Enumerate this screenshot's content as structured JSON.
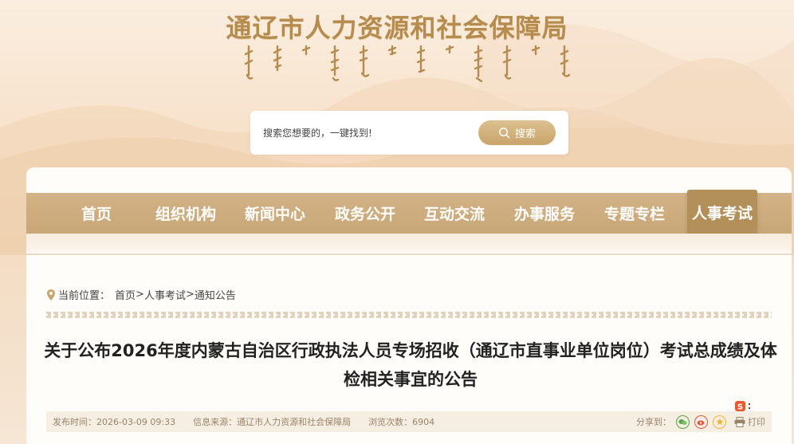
{
  "header": {
    "site_title": "通辽市人力资源和社会保障局"
  },
  "search": {
    "placeholder": "搜索您想要的，一键找到!",
    "button_label": "搜索"
  },
  "nav": {
    "items": [
      {
        "label": "首页"
      },
      {
        "label": "组织机构"
      },
      {
        "label": "新闻中心"
      },
      {
        "label": "政务公开"
      },
      {
        "label": "互动交流"
      },
      {
        "label": "办事服务"
      },
      {
        "label": "专题专栏"
      },
      {
        "label": "人事考试",
        "active": true
      }
    ]
  },
  "breadcrumb": {
    "prefix": "当前位置：",
    "items": [
      "首页",
      "人事考试",
      "通知公告"
    ],
    "separator": ">"
  },
  "article": {
    "title": "关于公布2026年度内蒙古自治区行政执法人员专场招收（通辽市直事业单位岗位）考试总成绩及体检相关事宜的公告",
    "publish_time": "发布时间：2026-03-09 09:33",
    "source": "信息来源：通辽市人力资源和社会保障局",
    "views": "浏览次数：6904",
    "share_label": "分享到：",
    "print_label": "打印"
  },
  "icons": [
    "location-pin-icon",
    "search-icon",
    "wechat-icon",
    "weibo-icon",
    "qzone-icon",
    "print-icon",
    "sogou-icon"
  ],
  "colors": {
    "brand_gold": "#b68b4e",
    "nav_bg": "#cdae80",
    "nav_active": "#b38f5a",
    "meta_bg": "#f6eee2"
  }
}
